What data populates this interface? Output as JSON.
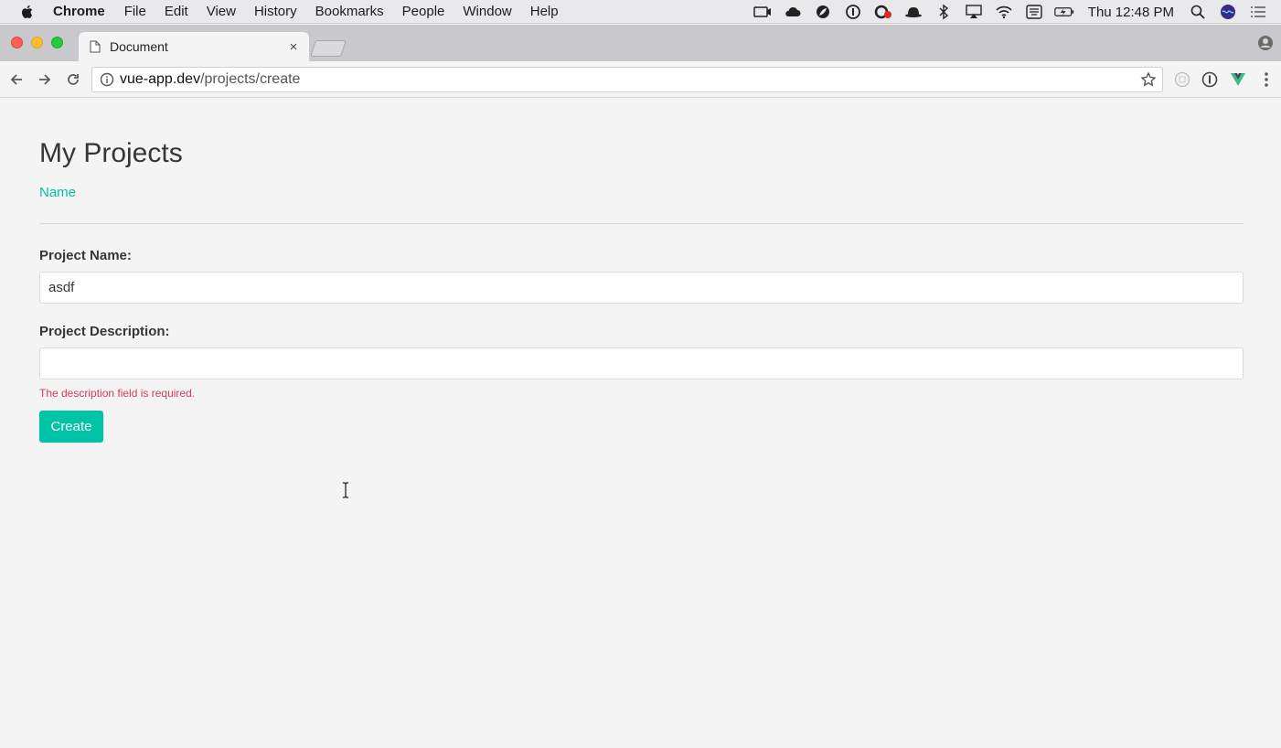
{
  "menubar": {
    "app_name": "Chrome",
    "items": [
      "File",
      "Edit",
      "View",
      "History",
      "Bookmarks",
      "People",
      "Window",
      "Help"
    ],
    "clock": "Thu 12:48 PM"
  },
  "browser": {
    "tab_title": "Document",
    "tab_close": "×",
    "url_host": "vue-app.dev",
    "url_path": "/projects/create"
  },
  "page": {
    "title": "My Projects",
    "nav_link": "Name",
    "form": {
      "name_label": "Project Name:",
      "name_value": "asdf",
      "description_label": "Project Description:",
      "description_value": "",
      "description_error": "The description field is required.",
      "submit_label": "Create"
    }
  },
  "colors": {
    "accent": "#00c4a7",
    "danger": "#d8395f",
    "page_bg": "#f4f4f4"
  }
}
